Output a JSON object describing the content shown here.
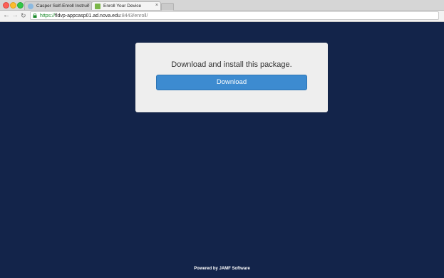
{
  "browser": {
    "tabs": [
      {
        "title": "Casper Self-Enroll Instruc",
        "close": "×",
        "active": false,
        "icon": "casper-favicon-icon"
      },
      {
        "title": "Enroll Your Device",
        "close": "×",
        "active": true,
        "icon": "jamf-favicon-icon"
      }
    ],
    "nav": {
      "back": "←",
      "forward": "→",
      "reload": "↻"
    },
    "address": {
      "scheme": "https://",
      "host": "fldvp-appcasp01.ad.nova.edu",
      "rest": ":8443/enroll/"
    }
  },
  "page": {
    "message": "Download and install this package.",
    "download_label": "Download",
    "footer": "Powered by JAMF Software"
  },
  "colors": {
    "background": "#13244a",
    "card": "#eeeeee",
    "button": "#3d8bd0",
    "url_secure": "#1a8a2a"
  }
}
